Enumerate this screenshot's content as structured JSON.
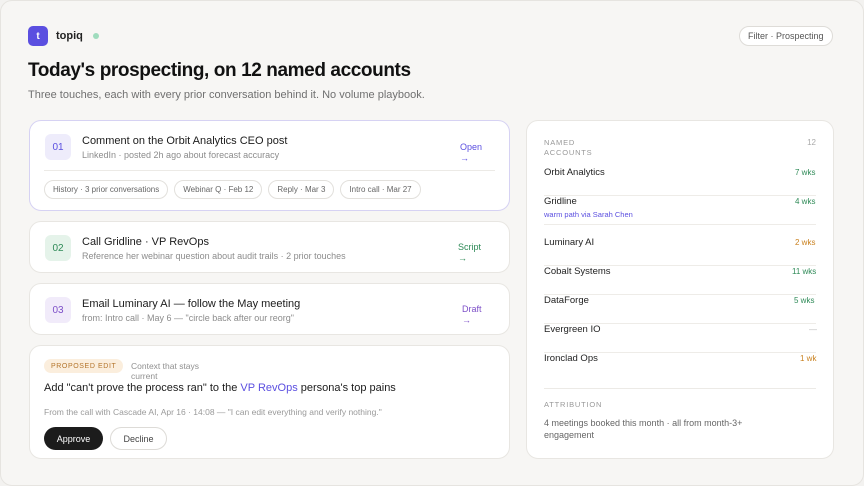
{
  "brand": {
    "logo_letter": "t",
    "name": "topiq"
  },
  "filter_label": "Filter · Prospecting",
  "header": {
    "title": "Today's prospecting, on 12 named accounts",
    "subtitle": "Three touches, each with every prior conversation behind it. No volume playbook."
  },
  "touches": [
    {
      "number": "01",
      "title": "Comment on the Orbit Analytics CEO post",
      "detail": "LinkedIn · posted 2h ago about forecast accuracy",
      "action": "Open",
      "arrow": "→",
      "chips": [
        "History · 3 prior conversations",
        "Webinar Q · Feb 12",
        "Reply · Mar 3",
        "Intro call · Mar 27"
      ]
    },
    {
      "number": "02",
      "title": "Call Gridline · VP RevOps",
      "detail": "Reference her webinar question about audit trails · 2 prior touches",
      "action": "Script",
      "arrow": "→"
    },
    {
      "number": "03",
      "title": "Email Luminary AI — follow the May meeting",
      "detail": "from: Intro call · May 6 — \"circle back after our reorg\"",
      "action": "Draft",
      "arrow": "→"
    }
  ],
  "proposed_edit": {
    "badge": "PROPOSED EDIT",
    "context": "Context that stays current",
    "text_before": "Add \"can't prove the process ran\" to the ",
    "highlight": "VP RevOps",
    "text_after": " persona's top pains",
    "source": "From the call with Cascade AI, Apr 16 · 14:08 — \"I can edit everything and verify nothing.\"",
    "approve": "Approve",
    "decline": "Decline"
  },
  "accounts_panel": {
    "label": "NAMED ACCOUNTS",
    "count": "12",
    "accounts": [
      {
        "name": "Orbit Analytics",
        "value": "7 wks",
        "status": "green"
      },
      {
        "name": "Gridline",
        "value": "4 wks",
        "status": "green",
        "note": "warm path via Sarah Chen"
      },
      {
        "name": "Luminary AI",
        "value": "2 wks",
        "status": "orange"
      },
      {
        "name": "Cobalt Systems",
        "value": "11 wks",
        "status": "green"
      },
      {
        "name": "DataForge",
        "value": "5 wks",
        "status": "green"
      },
      {
        "name": "Evergreen IO",
        "value": "—",
        "status": "gray"
      },
      {
        "name": "Ironclad Ops",
        "value": "1 wk",
        "status": "orange"
      }
    ],
    "attribution_label": "ATTRIBUTION",
    "attribution_text": "4 meetings booked this month · all from month-3+ engagement"
  },
  "colors": {
    "accent": "#5b4fe0",
    "green": "#2e8a57",
    "orange": "#c9801e",
    "badge_bg": "#fbeedd"
  }
}
